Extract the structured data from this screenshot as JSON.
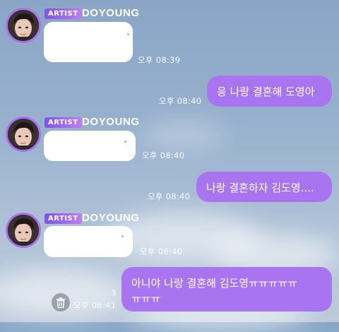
{
  "artist": {
    "badge": "ARTIST",
    "name": "DOYOUNG"
  },
  "messages": [
    {
      "side": "in",
      "time": "오후 08:39",
      "text": ""
    },
    {
      "side": "out",
      "time": "오후 08:40",
      "text": "응 나랑 결혼해 도영아"
    },
    {
      "side": "in",
      "time": "오후 08:40",
      "text": ""
    },
    {
      "side": "out",
      "time": "오후 08:40",
      "text": "나랑 결혼하자 김도영...."
    },
    {
      "side": "in",
      "time": "오후 08:40",
      "text": ""
    },
    {
      "side": "out",
      "time": "오후 08:41",
      "line1": "아니야 나랑 결혼해 김도영ㅠㅠㅠㅠㅠ",
      "line2": "ㅠㅠㅠ",
      "unread": "1"
    }
  ],
  "icons": {
    "delete": "trash-icon",
    "avatar": "artist-avatar"
  },
  "colors": {
    "bubble_out": "#a974f0",
    "avatar_ring": "#a772ea",
    "badge_start": "#7b55e6",
    "badge_end": "#c27cf1"
  }
}
